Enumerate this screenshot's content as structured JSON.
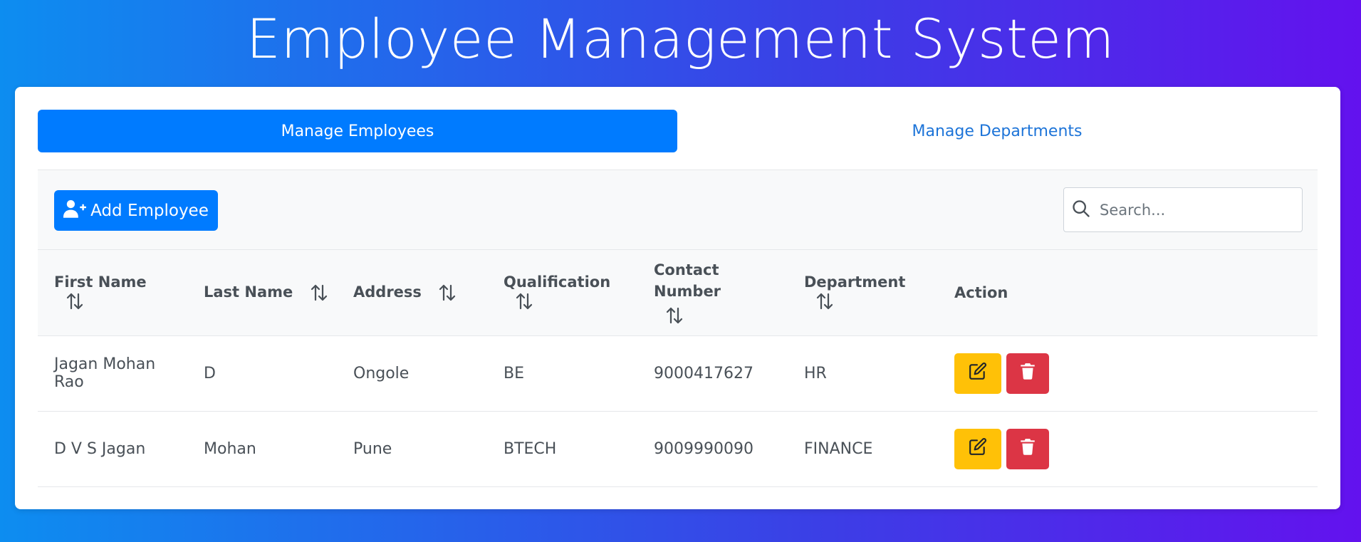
{
  "page": {
    "title": "Employee Management System"
  },
  "tabs": [
    {
      "label": "Manage Employees",
      "active": true
    },
    {
      "label": "Manage Departments",
      "active": false
    }
  ],
  "toolbar": {
    "add_button_label": "Add Employee",
    "add_button_icon": "user-plus-icon",
    "search_placeholder": "Search...",
    "search_value": "",
    "search_icon": "search-icon"
  },
  "table": {
    "columns": [
      {
        "label": "First Name",
        "sortable": true
      },
      {
        "label": "Last Name",
        "sortable": true
      },
      {
        "label": "Address",
        "sortable": true
      },
      {
        "label": "Qualification",
        "sortable": true
      },
      {
        "label": "Contact Number",
        "sortable": true
      },
      {
        "label": "Department",
        "sortable": true
      },
      {
        "label": "Action",
        "sortable": false
      }
    ],
    "rows": [
      {
        "first_name": "Jagan Mohan Rao",
        "last_name": "D",
        "address": "Ongole",
        "qualification": "BE",
        "contact": "9000417627",
        "department": "HR"
      },
      {
        "first_name": "D V S Jagan",
        "last_name": "Mohan",
        "address": "Pune",
        "qualification": "BTECH",
        "contact": "9009990090",
        "department": "FINANCE"
      }
    ],
    "row_actions": {
      "edit_icon": "edit-icon",
      "delete_icon": "trash-icon"
    }
  },
  "colors": {
    "primary": "#007bff",
    "warning": "#ffc107",
    "danger": "#dc3545",
    "gradient_start": "#0d8df0",
    "gradient_end": "#6312ee"
  }
}
